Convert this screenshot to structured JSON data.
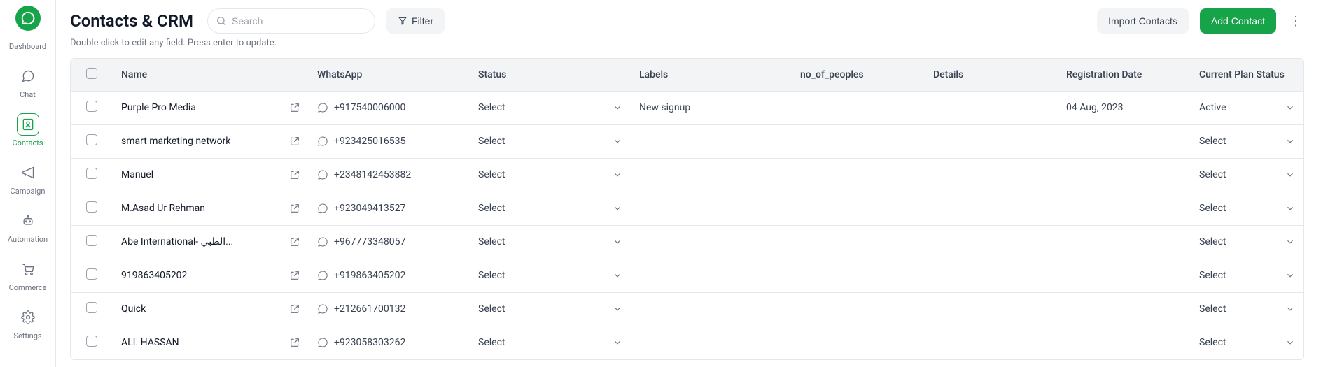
{
  "sidebar": {
    "items": [
      {
        "label": "Dashboard"
      },
      {
        "label": "Chat"
      },
      {
        "label": "Contacts"
      },
      {
        "label": "Campaign"
      },
      {
        "label": "Automation"
      },
      {
        "label": "Commerce"
      },
      {
        "label": "Settings"
      }
    ]
  },
  "header": {
    "title": "Contacts & CRM",
    "search_placeholder": "Search",
    "filter_label": "Filter",
    "import_label": "Import Contacts",
    "add_label": "Add Contact",
    "subhead": "Double click to edit any field. Press enter to update."
  },
  "table": {
    "columns": {
      "name": "Name",
      "whatsapp": "WhatsApp",
      "status": "Status",
      "labels": "Labels",
      "no_of_peoples": "no_of_peoples",
      "details": "Details",
      "registration_date": "Registration Date",
      "current_plan_status": "Current Plan Status"
    },
    "select_placeholder": "Select",
    "rows": [
      {
        "name": "Purple Pro Media",
        "whatsapp": "+917540006000",
        "status": "Select",
        "labels": "New signup",
        "no_of_peoples": "",
        "details": "",
        "registration_date": "04 Aug, 2023",
        "current_plan_status": "Active"
      },
      {
        "name": "smart marketing network",
        "whatsapp": "+923425016535",
        "status": "Select",
        "labels": "",
        "no_of_peoples": "",
        "details": "",
        "registration_date": "",
        "current_plan_status": "Select"
      },
      {
        "name": "Manuel",
        "whatsapp": "+2348142453882",
        "status": "Select",
        "labels": "",
        "no_of_peoples": "",
        "details": "",
        "registration_date": "",
        "current_plan_status": "Select"
      },
      {
        "name": "M.Asad Ur Rehman",
        "whatsapp": "+923049413527",
        "status": "Select",
        "labels": "",
        "no_of_peoples": "",
        "details": "",
        "registration_date": "",
        "current_plan_status": "Select"
      },
      {
        "name": "Abe International- الطبي...",
        "whatsapp": "+967773348057",
        "status": "Select",
        "labels": "",
        "no_of_peoples": "",
        "details": "",
        "registration_date": "",
        "current_plan_status": "Select"
      },
      {
        "name": "919863405202",
        "whatsapp": "+919863405202",
        "status": "Select",
        "labels": "",
        "no_of_peoples": "",
        "details": "",
        "registration_date": "",
        "current_plan_status": "Select"
      },
      {
        "name": "Quick",
        "whatsapp": "+212661700132",
        "status": "Select",
        "labels": "",
        "no_of_peoples": "",
        "details": "",
        "registration_date": "",
        "current_plan_status": "Select"
      },
      {
        "name": "ALI. HASSAN",
        "whatsapp": "+923058303262",
        "status": "Select",
        "labels": "",
        "no_of_peoples": "",
        "details": "",
        "registration_date": "",
        "current_plan_status": "Select"
      }
    ]
  }
}
